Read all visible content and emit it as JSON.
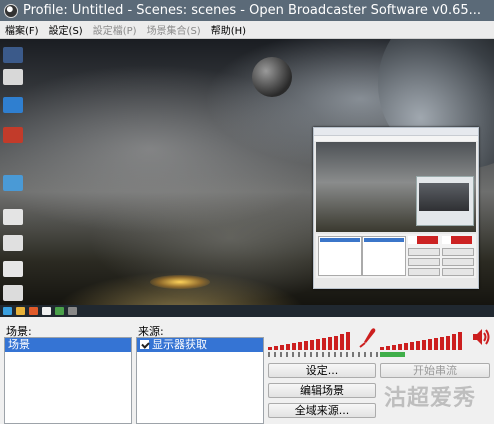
{
  "window": {
    "title": "Profile: Untitled - Scenes: scenes - Open Broadcaster Software v0.65..."
  },
  "menu": [
    {
      "label": "檔案(F)",
      "disabled": false
    },
    {
      "label": "設定(S)",
      "disabled": false
    },
    {
      "label": "設定檔(P)",
      "disabled": true
    },
    {
      "label": "场景集合(S)",
      "disabled": true
    },
    {
      "label": "帮助(H)",
      "disabled": false
    }
  ],
  "scenes": {
    "label": "场景:",
    "items": [
      "场景"
    ]
  },
  "sources": {
    "label": "来源:",
    "items": [
      {
        "label": "显示器获取",
        "checked": true
      }
    ]
  },
  "audio": {
    "mic_icon": "microphone-icon",
    "speaker_icon": "speaker-icon",
    "accent_color": "#cc1f1f"
  },
  "buttons": {
    "settings": "设定...",
    "start_stream": "开始串流",
    "edit_scene": "编辑场景",
    "global_sources": "全域来源..."
  },
  "watermark": "沽超爱秀"
}
